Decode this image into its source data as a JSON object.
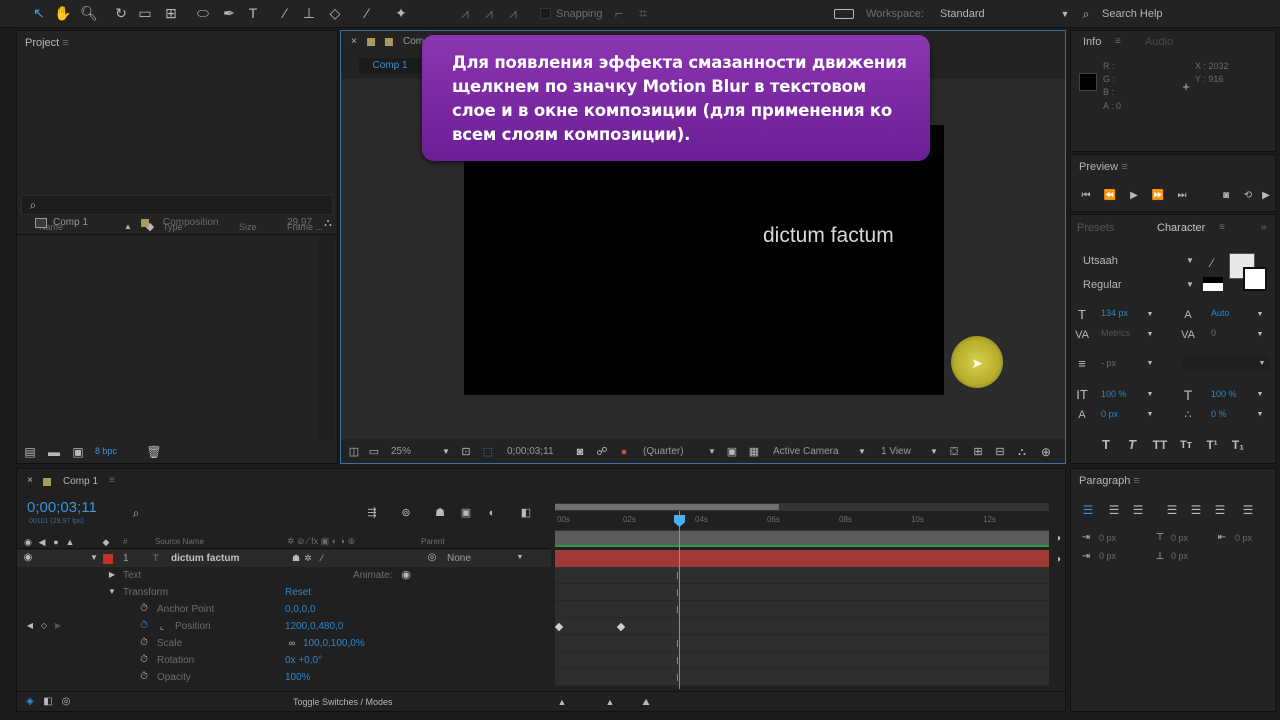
{
  "toolbar": {
    "snapping": "Snapping",
    "workspace_label": "Workspace:",
    "workspace_value": "Standard",
    "search_help": "Search Help"
  },
  "project": {
    "title": "Project",
    "cols": {
      "name": "Name",
      "type": "Type",
      "size": "Size",
      "frame": "Frame ..."
    },
    "item": {
      "name": "Comp 1",
      "type": "Composition",
      "frame": "29,97"
    },
    "bpc": "8 bpc"
  },
  "comp": {
    "tab": "Comp 1",
    "tab_head": "Com",
    "zoom": "25%",
    "timecode": "0;00;03;11",
    "resolution": "(Quarter)",
    "camera": "Active Camera",
    "views": "1 View",
    "text": "dictum factum"
  },
  "tooltip": "Для появления эффекта смазанности движения щелкнем по значку Motion Blur в текстовом слое и в окне композиции (для применения ко всем слоям композиции).",
  "info": {
    "tab1": "Info",
    "tab2": "Audio",
    "r": "R :",
    "g": "G :",
    "b": "B :",
    "a": "A : 0",
    "x": "X : 2032",
    "y": "Y : 916"
  },
  "preview": {
    "title": "Preview"
  },
  "character": {
    "tab1": "Presets",
    "tab2": "Character",
    "font": "Utsaah",
    "style": "Regular",
    "size": "134 px",
    "leading": "Auto",
    "kern": "Metrics",
    "track": "0",
    "stroke": "- px",
    "vscale": "100 %",
    "hscale": "100 %",
    "baseline": "0 px",
    "tsume": "0 %"
  },
  "paragraph": {
    "title": "Paragraph",
    "v1": "0 px",
    "v2": "0 px",
    "v3": "0 px",
    "v4": "0 px",
    "v5": "0 px"
  },
  "timeline": {
    "tab": "Comp 1",
    "timecode": "0;00;03;11",
    "fps": "00101 (29.97 fps)",
    "col_source": "Source Name",
    "col_parent": "Parent",
    "layer_num": "1",
    "layer_name": "dictum factum",
    "parent_value": "None",
    "text": "Text",
    "animate": "Animate:",
    "transform": "Transform",
    "reset": "Reset",
    "props": [
      {
        "name": "Anchor Point",
        "value": "0,0,0,0"
      },
      {
        "name": "Position",
        "value": "1200,0,480,0"
      },
      {
        "name": "Scale",
        "value": "100,0,100,0%"
      },
      {
        "name": "Rotation",
        "value": "0x +0,0°"
      },
      {
        "name": "Opacity",
        "value": "100%"
      }
    ],
    "ruler": [
      "00s",
      "02s",
      "04s",
      "06s",
      "08s",
      "10s",
      "12s"
    ],
    "toggle": "Toggle Switches / Modes"
  }
}
